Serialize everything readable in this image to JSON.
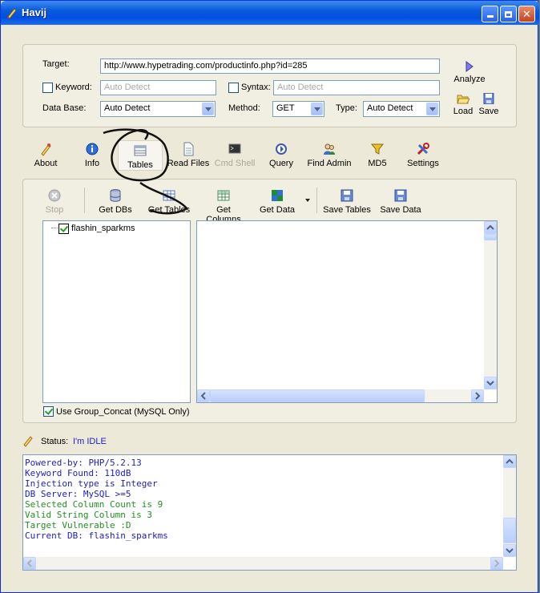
{
  "window": {
    "title": "Havij"
  },
  "target": {
    "label": "Target:",
    "url": "http://www.hypetrading.com/productinfo.php?id=285",
    "keyword_label": "Keyword:",
    "keyword_placeholder": "Auto Detect",
    "syntax_label": "Syntax:",
    "syntax_placeholder": "Auto Detect",
    "database_label": "Data Base:",
    "database_value": "Auto Detect",
    "method_label": "Method:",
    "method_value": "GET",
    "type_label": "Type:",
    "type_value": "Auto Detect",
    "analyze_label": "Analyze",
    "load_label": "Load",
    "save_label": "Save"
  },
  "tabs": [
    {
      "label": "About"
    },
    {
      "label": "Info"
    },
    {
      "label": "Tables"
    },
    {
      "label": "Read Files"
    },
    {
      "label": "Cmd Shell"
    },
    {
      "label": "Query"
    },
    {
      "label": "Find Admin"
    },
    {
      "label": "MD5"
    },
    {
      "label": "Settings"
    }
  ],
  "toolbar": [
    {
      "label": "Stop"
    },
    {
      "label": "Get DBs"
    },
    {
      "label": "Get Tables"
    },
    {
      "label": "Get Columns"
    },
    {
      "label": "Get Data"
    },
    {
      "label": "Save Tables"
    },
    {
      "label": "Save Data"
    }
  ],
  "tree": {
    "items": [
      {
        "label": "flashin_sparkms",
        "checked": true
      }
    ]
  },
  "group_concat": {
    "label": "Use Group_Concat (MySQL Only)",
    "checked": true
  },
  "status": {
    "label": "Status:",
    "value": "I'm IDLE"
  },
  "log": {
    "lines": [
      {
        "text": "Powered-by: PHP/5.2.13",
        "color": "#2020c0"
      },
      {
        "text": "Keyword Found: 110dB",
        "color": "#2020c0"
      },
      {
        "text": "Injection type is Integer",
        "color": "#2020c0"
      },
      {
        "text": "DB Server: MySQL >=5",
        "color": "#2020c0"
      },
      {
        "text": "Selected Column Count is 9",
        "color": "#209020"
      },
      {
        "text": "Valid String Column is 3",
        "color": "#209020"
      },
      {
        "text": "Target Vulnerable :D",
        "color": "#209020"
      },
      {
        "text": "Current DB: flashin_sparkms",
        "color": "#2020c0"
      }
    ]
  },
  "colors": {
    "titlebar": "#0a5bdb",
    "accent": "#7f9db9",
    "log_blue": "#2020c0",
    "log_green": "#209020",
    "annotation": "#000000"
  }
}
